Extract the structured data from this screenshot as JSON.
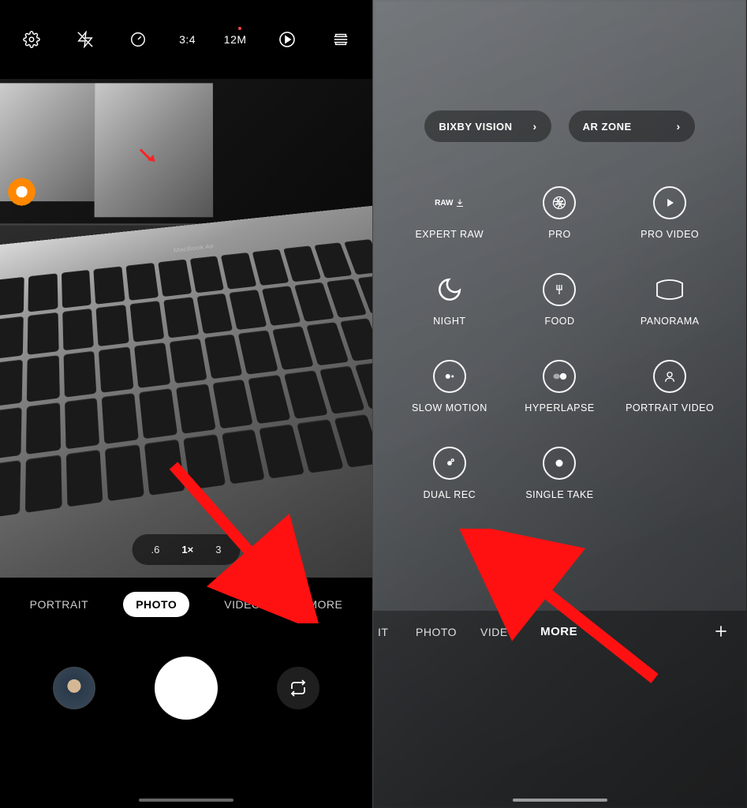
{
  "left": {
    "top": {
      "ratio": "3:4",
      "megapixels": "12M"
    },
    "macbook_label": "MacBook Air",
    "zoom": {
      "wide": ".6",
      "normal": "1×",
      "tele": "3"
    },
    "modes": {
      "portrait": "PORTRAIT",
      "photo": "PHOTO",
      "video": "VIDEO",
      "more": "MORE"
    }
  },
  "right": {
    "chips": {
      "bixby": "BIXBY VISION",
      "arzone": "AR ZONE"
    },
    "tiles": {
      "expert_raw": "EXPERT RAW",
      "pro": "PRO",
      "pro_video": "PRO VIDEO",
      "night": "NIGHT",
      "food": "FOOD",
      "panorama": "PANORAMA",
      "slow_motion": "SLOW MOTION",
      "hyperlapse": "HYPERLAPSE",
      "portrait_video": "PORTRAIT VIDEO",
      "dual_rec": "DUAL REC",
      "single_take": "SINGLE TAKE"
    },
    "raw_text": "RAW",
    "modes": {
      "portrait_cut": "IT",
      "photo": "PHOTO",
      "video": "VIDEO",
      "more": "MORE"
    }
  }
}
